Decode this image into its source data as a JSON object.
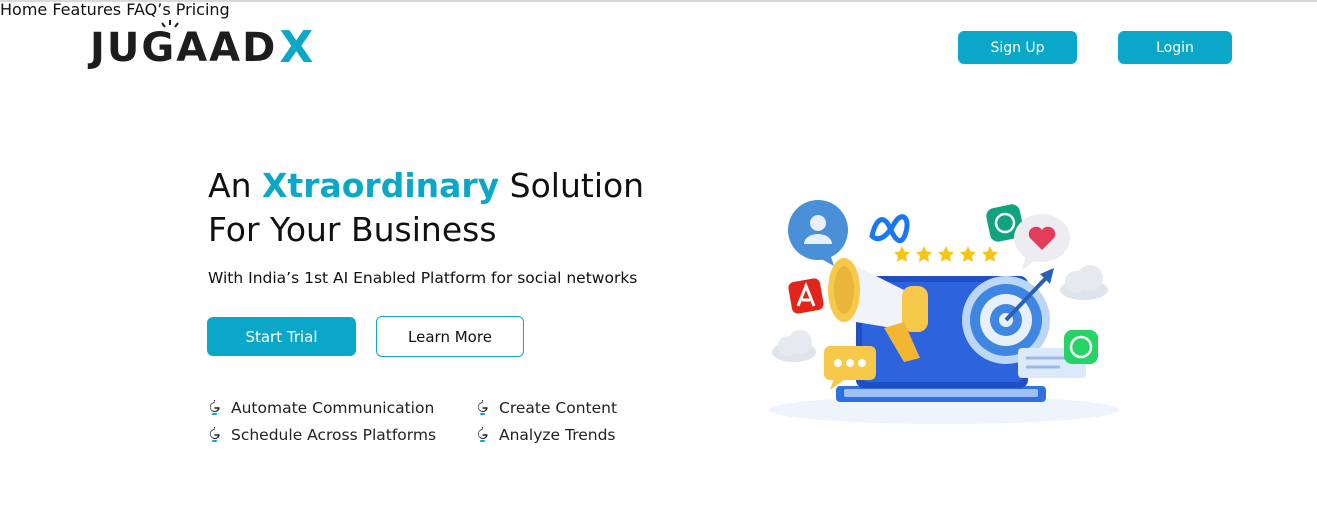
{
  "brand": {
    "logo_text": "JUGAAD",
    "logo_x": "X",
    "accent_color": "#0aa7c9"
  },
  "nav": {
    "items": [
      {
        "label": "Home"
      },
      {
        "label": "Features"
      },
      {
        "label": "FAQ’s"
      },
      {
        "label": "Pricing"
      }
    ],
    "signup_label": "Sign Up",
    "login_label": "Login"
  },
  "hero": {
    "title_part1": "An ",
    "title_accent": "Xtraordinary",
    "title_part2": " Solution",
    "title_line2": "For Your Business",
    "subtitle": "With India’s 1st AI Enabled Platform for social networks",
    "primary_button": "Start Trial",
    "secondary_button": "Learn More"
  },
  "features": [
    {
      "label": "Automate Communication"
    },
    {
      "label": "Create Content"
    },
    {
      "label": "Schedule Across Platforms"
    },
    {
      "label": "Analyze Trends"
    }
  ],
  "illustration": {
    "icons": [
      "user-bubble-icon",
      "meta-icon",
      "chatgpt-icon",
      "heart-bubble-icon",
      "adobe-icon",
      "megaphone-icon",
      "target-icon",
      "whatsapp-icon",
      "chat-dots-icon",
      "cloud-icon",
      "laptop-icon",
      "star-icon"
    ],
    "stars": 5
  }
}
